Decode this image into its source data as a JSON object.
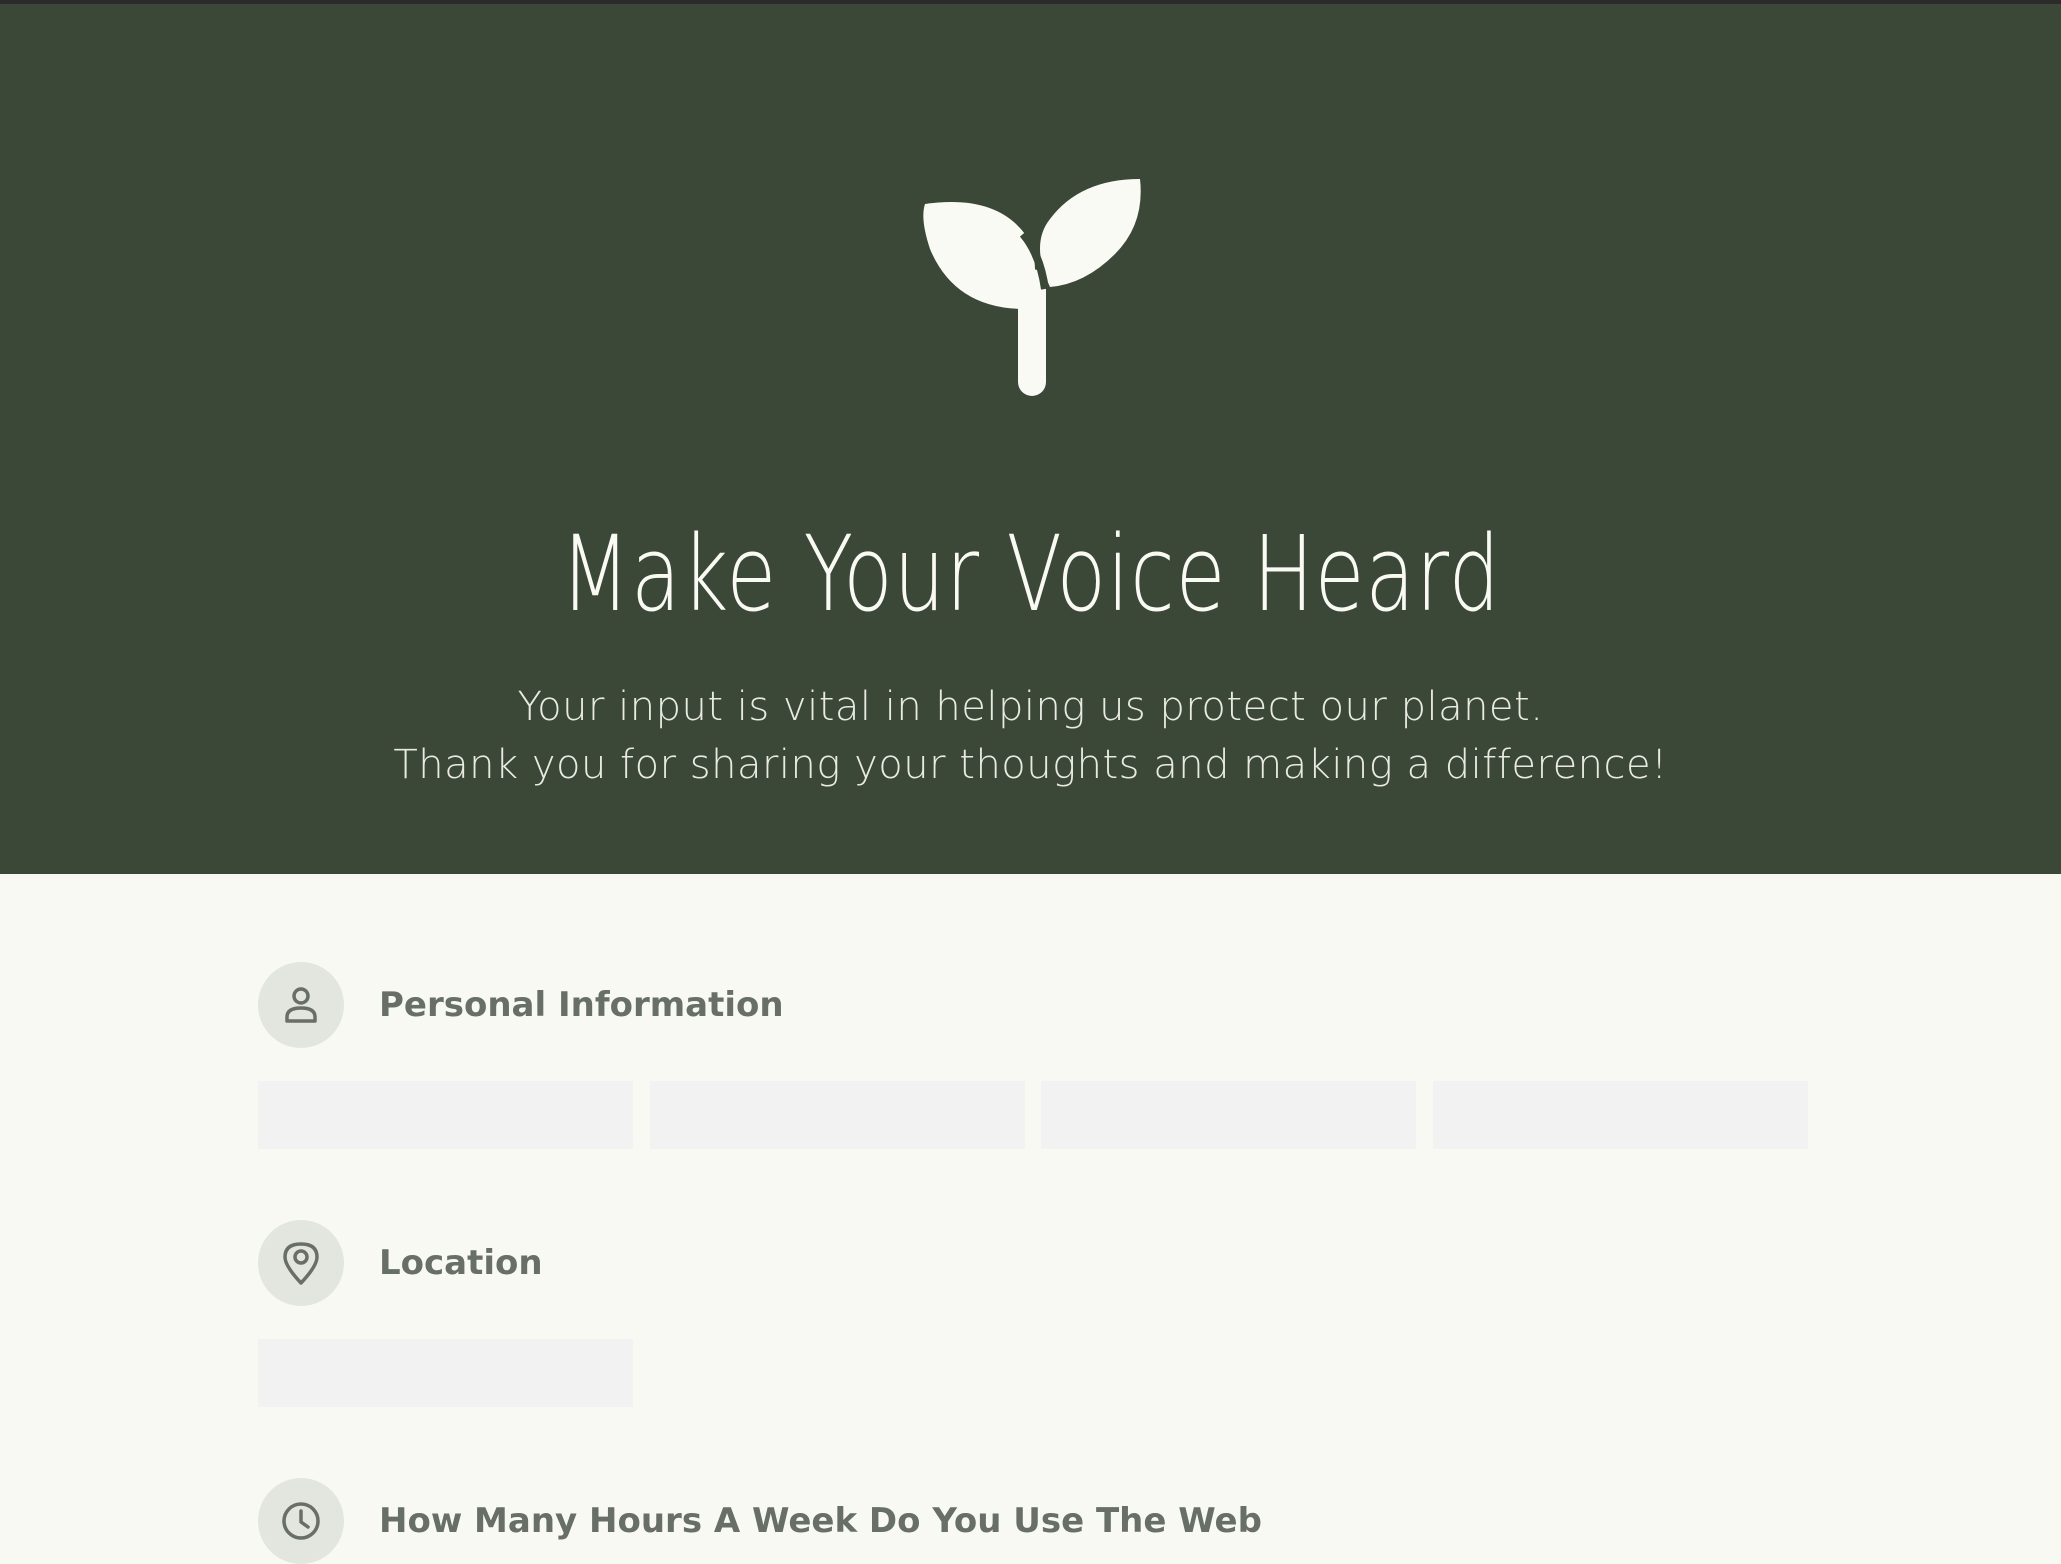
{
  "hero": {
    "logo_icon": "sprout-icon",
    "title": "Make Your Voice Heard",
    "subtitle_line1": "Your input is vital in helping us protect our planet.",
    "subtitle_line2": "Thank you for sharing your thoughts and making a difference!",
    "background_color": "#3b4838"
  },
  "sections": {
    "personal": {
      "icon": "user-icon",
      "title": "Personal Information",
      "fields": [
        {
          "value": "",
          "placeholder": ""
        },
        {
          "value": "",
          "placeholder": ""
        },
        {
          "value": "",
          "placeholder": ""
        },
        {
          "value": "",
          "placeholder": ""
        }
      ]
    },
    "location": {
      "icon": "map-pin-icon",
      "title": "Location",
      "fields": [
        {
          "value": "",
          "placeholder": ""
        }
      ]
    },
    "hours": {
      "icon": "clock-icon",
      "title": "How Many Hours A Week Do You Use The Web"
    }
  },
  "colors": {
    "page_background": "#f9f9f4",
    "accent": "#676f66",
    "field_background": "#f2f2f2"
  }
}
